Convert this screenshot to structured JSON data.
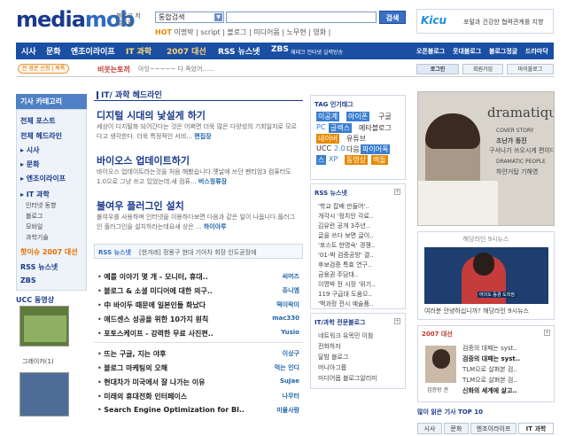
{
  "header": {
    "logo_main": "media",
    "logo_accent": "mob",
    "logo_sub": "블로그 저널리즘",
    "search_select": "통합검색",
    "search_button": "검색",
    "hot_label": "HOT",
    "hot_keywords": "이명박 | script | 블로그 | 미디어몹 | 노무현 | 영화 |",
    "ad_brand": "Kicu",
    "ad_text": "포털과 건강한 협력관계를 지향"
  },
  "nav": {
    "items": [
      "시사",
      "문화",
      "엔조이라이프",
      "IT 과학",
      "2007 대선",
      "RSS 뉴스넷",
      "ZBS",
      "오픈블로그",
      "웃대블로그",
      "블로그정글",
      "드라마닥"
    ],
    "zbs_sub": "재테크 인터넷 실력방송"
  },
  "subnav": {
    "badge": "전 영문 신청 | 목록",
    "headline": "비웃는토끼",
    "headline_sub": "아잉~~~~~ 다 죽었어......",
    "login": "로그인",
    "join": "회원가입",
    "mypage": "마이블로그"
  },
  "left": {
    "category_title": "기사 카테고리",
    "items": [
      {
        "label": "전체 포스트",
        "type": "b"
      },
      {
        "label": "전체 헤드라인",
        "type": "b"
      },
      {
        "label": "▸ 시사",
        "type": "b"
      },
      {
        "label": "▸ 문화",
        "type": "b"
      },
      {
        "label": "▸ 엔조이라이프",
        "type": "b"
      },
      {
        "label": "▸ IT 과학",
        "type": "b"
      },
      {
        "label": "인터넷 동향",
        "type": "sub"
      },
      {
        "label": "블로그",
        "type": "sub"
      },
      {
        "label": "모바일",
        "type": "sub"
      },
      {
        "label": "과학기술",
        "type": "sub"
      },
      {
        "label": "핫이슈 2007 대선",
        "type": "orange"
      },
      {
        "label": "RSS 뉴스넷",
        "type": "b"
      },
      {
        "label": "ZBS",
        "type": "b"
      }
    ],
    "ucc_title": "UCC 동영상",
    "ucc_caption": "그레이카(1)"
  },
  "main": {
    "section_title": "IT/ 과학 헤드라인",
    "stories": [
      {
        "title": "디지털 시대의 낯설게 하기",
        "body": "세상이 디지털화 되어간다는 것은 어쩌면 더욱 많은 다양성의 기회일지로 모르다고 생각한다. 더욱 특정적인 서비...",
        "more": "편집장"
      },
      {
        "title": "바이오스 업데이트하기",
        "body": "바이오스 업데이트라는것을 처음 해봤습니다.옛날에 쓰던 펜티엄3 컴퓨터도 1.0으로 그냥 쓰고 있었는데.새 컴퓨...",
        "more": "버스정류장"
      },
      {
        "title": "불여우 플러그인 설치",
        "body": "불여우를 사용하며 인터넷을 이용하다보면 다음과 같은 일이 나옵니다.플러그인 플러그인을 설치하라는데요새 상은 ...",
        "more": "하이아루"
      }
    ],
    "rss_label": "RSS 뉴스넷",
    "rss_headline": "[한겨레] 정몽구 현대 기아차 회장 인도공장에",
    "list1": [
      {
        "title": "예를 이야기 몇 개 - 모니터, 휴대..",
        "author": "씨머즈"
      },
      {
        "title": "블로그 & 소셜 미디어에 대한 의구..",
        "author": "쥬니엠"
      },
      {
        "title": "中 바이두 때문에 일본인들 화났다",
        "author": "떡이락이"
      },
      {
        "title": "애드센스 성공을 위한 10가지 원칙",
        "author": "mac330"
      },
      {
        "title": "포토스케이프 - 강력한 무료 사진편..",
        "author": "Yusio"
      }
    ],
    "list2": [
      {
        "title": "뜨는 구글, 지는 야후",
        "author": "이상구"
      },
      {
        "title": "블로그 마케팅의 오해",
        "author": "먹는 인디"
      },
      {
        "title": "현대차가 미국에서 잘 나가는 이유",
        "author": "SuJae"
      },
      {
        "title": "미래의 휴대전화 인터페이스",
        "author": "나무터"
      },
      {
        "title": "Search Engine Optimization for Bl..",
        "author": "미물사랑"
      }
    ]
  },
  "mid": {
    "tag_title": "TAG 인기태그",
    "tags": [
      {
        "t": "이공계",
        "c": "tb1"
      },
      {
        "t": "아이폰",
        "c": "tb1"
      },
      {
        "t": "구글",
        "c": "tc1"
      },
      {
        "t": "PC",
        "c": "tc2"
      },
      {
        "t": "글렉스",
        "c": "tb1"
      },
      {
        "t": "메타블로그",
        "c": "tc1"
      },
      {
        "t": "네이버",
        "c": "tb2"
      },
      {
        "t": "유튜브",
        "c": "tc1"
      },
      {
        "t": "UCC",
        "c": "tc1"
      },
      {
        "t": "2.0",
        "c": "tc2"
      },
      {
        "t": "다음",
        "c": "tc1"
      },
      {
        "t": "파이어폭",
        "c": "tb1"
      },
      {
        "t": "스",
        "c": "tb1"
      },
      {
        "t": "XP",
        "c": "tc2"
      },
      {
        "t": "동영상",
        "c": "tb2"
      },
      {
        "t": "벽돌",
        "c": "tb2"
      }
    ],
    "rss_title": "RSS 뉴스넷",
    "rss_items": [
      "'학교 잡배 만들어'..",
      "개각시 '정치인 각료..",
      "김유란 공개 3주년..",
      "글을 쓰다 보면 글이..",
      "'포스트 한명숙' 경쟁..",
      "'01-박 검증공방' 결..",
      "후보검증 특효 연구..",
      "금융권 주담대..",
      "이명박 전 시장 '위기..",
      "119 구급대 도움으..",
      "'백과정 전시 예술품.."
    ],
    "blog_title": "IT/과학 전문블로그",
    "blog_items": [
      "네트워크 유목민 이참",
      "전화하자",
      "달밤 블로그",
      "머니아그룹",
      "미디어몹 블로그알리미"
    ]
  },
  "right": {
    "magazine_title": "dramatique",
    "mag_lines": [
      "COVER STORY",
      "조난가 동진",
      "구서나기 쓰오시게 편이다",
      "DRAMATIC PEOPLE",
      "하얀거탑 기해영"
    ],
    "tv_title": "해당라인 9시뉴스",
    "tv_caption": "여러분 안녕하십니까? 해당라인 9시뉴스",
    "tv_overlay": "여의도 동경 도착점",
    "e2007_title": "2007 대선",
    "e2007_caption": "검증왕 권",
    "e2007_items": [
      "검증의 대패는 syst..",
      "검증의 대패는 syst..",
      "TLM으로 살펴본 검..",
      "TLM으로 살펴본 검..",
      "신화의 세계에 살고.."
    ],
    "top10_title": "많이 읽은 기사 TOP 10",
    "tabs": [
      "시사",
      "문화",
      "엔조이라이프",
      "IT 과학"
    ]
  }
}
